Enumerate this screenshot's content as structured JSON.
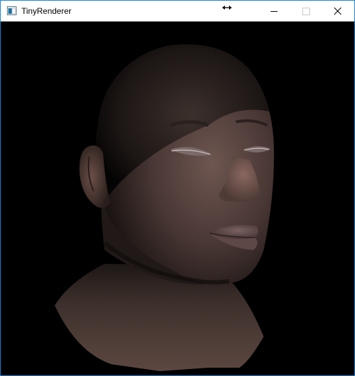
{
  "window": {
    "title": "TinyRenderer",
    "icons": {
      "app": "app-window-icon",
      "resize": "resize-horizontal-icon",
      "minimize": "minimize-icon",
      "maximize": "maximize-icon",
      "close": "close-icon"
    }
  },
  "viewport": {
    "content": "rendered-3d-head-model",
    "background": "#000000",
    "skin_color": "#5a4540"
  }
}
